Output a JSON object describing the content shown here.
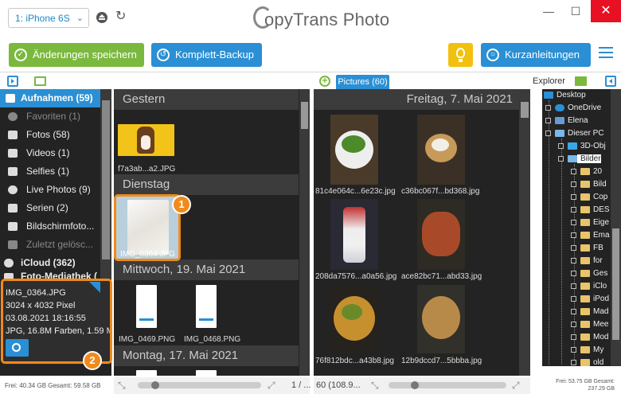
{
  "titlebar": {
    "device": "1: iPhone 6S",
    "app_title": "opyTrans Photo",
    "minimize": "—",
    "maximize": "☐",
    "close": "✕"
  },
  "toolbar": {
    "save_label": "Änderungen speichern",
    "backup_label": "Komplett-Backup",
    "guide_label": "Kurzanleitungen"
  },
  "sidebar": {
    "items": [
      {
        "label": "Aufnahmen (59)",
        "icon": "camera-roll-icon"
      },
      {
        "label": "Favoriten (1)",
        "icon": "heart-icon"
      },
      {
        "label": "Fotos (58)",
        "icon": "camera-icon"
      },
      {
        "label": "Videos (1)",
        "icon": "video-icon"
      },
      {
        "label": "Selfies (1)",
        "icon": "selfie-icon"
      },
      {
        "label": "Live Photos (9)",
        "icon": "live-photo-icon"
      },
      {
        "label": "Serien (2)",
        "icon": "burst-icon"
      },
      {
        "label": "Bildschirmfoto...",
        "icon": "screenshot-icon"
      },
      {
        "label": "Zuletzt gelösc...",
        "icon": "trash-icon"
      },
      {
        "label": "iCloud (362)",
        "icon": "cloud-icon"
      },
      {
        "label": "Foto-Mediathek (",
        "icon": "library-icon"
      }
    ],
    "free_space": "Frei: 40.34 GB Gesamt: 59.58 GB"
  },
  "info": {
    "filename": "IMG_0364.JPG",
    "resolution": "3024 x 4032 Pixel",
    "date": "03.08.2021 18:16:55",
    "format": "JPG, 16.8M Farben, 1.59 M"
  },
  "badges": {
    "one": "1",
    "two": "2"
  },
  "device_panel": {
    "groups": [
      {
        "date": "Gestern",
        "files": [
          "f7a3ab...a2.JPG"
        ]
      },
      {
        "date": "Dienstag",
        "files": [
          "IMG_0364.JPG"
        ]
      },
      {
        "date": "Mittwoch, 19. Mai 2021",
        "files": [
          "IMG_0469.PNG",
          "IMG_0468.PNG"
        ]
      },
      {
        "date": "Montag, 17. Mai 2021",
        "files": []
      }
    ],
    "page": "1 / ..."
  },
  "pictures": {
    "tab": "Pictures (60)",
    "date": "Freitag, 7. Mai 2021",
    "files": [
      "81c4e064c...6e23c.jpg",
      "c36bc067f...bd368.jpg",
      "208da7576...a0a56.jpg",
      "ace82bc71...abd33.jpg",
      "76f812bdc...a43b8.jpg",
      "12b9dccd7...5bbba.jpg"
    ],
    "count": "60 (108.9..."
  },
  "explorer": {
    "label": "Explorer",
    "tree": [
      "Desktop",
      "OneDrive",
      "Elena",
      "Dieser PC",
      "3D-Obj",
      "Bilder",
      "20",
      "Bild",
      "Cop",
      "DES",
      "Eige",
      "Ema",
      "FB",
      "for",
      "Ges",
      "iClo",
      "iPod",
      "Mad",
      "Mee",
      "Mod",
      "My",
      "old"
    ],
    "free_space_line1": "Frei: 53.75 GB Gesamt:",
    "free_space_line2": "237.29 GB"
  },
  "colors": {
    "accent": "#2a8fd4",
    "green": "#7ab93d",
    "orange": "#f08a1c",
    "dark": "#232323"
  }
}
